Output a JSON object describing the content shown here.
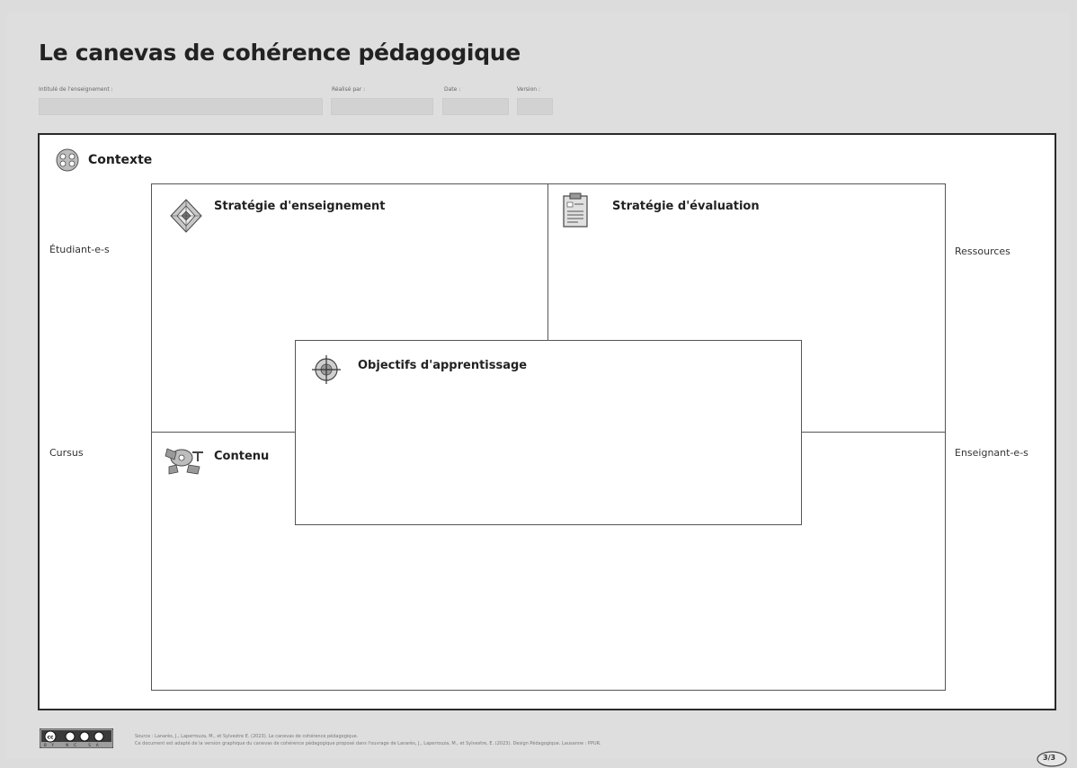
{
  "title": "Le canevas de cohérence pédagogique",
  "meta": {
    "intitule_label": "Intitulé de l'enseignement :",
    "realise_label": "Réalisé par :",
    "date_label": "Date :",
    "version_label": "Version :"
  },
  "context": {
    "label": "Contexte"
  },
  "side_labels": {
    "left_top": "Étudiant-e-s",
    "left_bottom": "Cursus",
    "right_top": "Ressources",
    "right_bottom": "Enseignant-e-s"
  },
  "sections": {
    "teaching": "Stratégie d'enseignement",
    "evaluation": "Stratégie d'évaluation",
    "objectives": "Objectifs d'apprentissage",
    "content": "Contenu"
  },
  "footer": {
    "line1": "Source : Lanarès, J., Laperrouza, M., et Sylvestre E. (2023). Le canevas de cohérence pédagogique.",
    "line2": "Ce document est adapté de la version graphique du canevas de cohérence pédagogique proposé dans l'ouvrage de Lanarès, J., Laperrouza, M., et Sylvestre, E. (2023). Design Pédagogique. Lausanne : PPUR.",
    "license": "BY NC SA",
    "page": "3/3"
  },
  "colors": {
    "background": "#dedede",
    "canvas": "#ffffff",
    "border": "#2a2a2a"
  },
  "icons": {
    "context": "network-circle-icon",
    "teaching": "diamond-target-icon",
    "evaluation": "clipboard-icon",
    "objectives": "crosshair-target-icon",
    "content": "puzzle-people-icon",
    "license": "creative-commons-icon"
  }
}
